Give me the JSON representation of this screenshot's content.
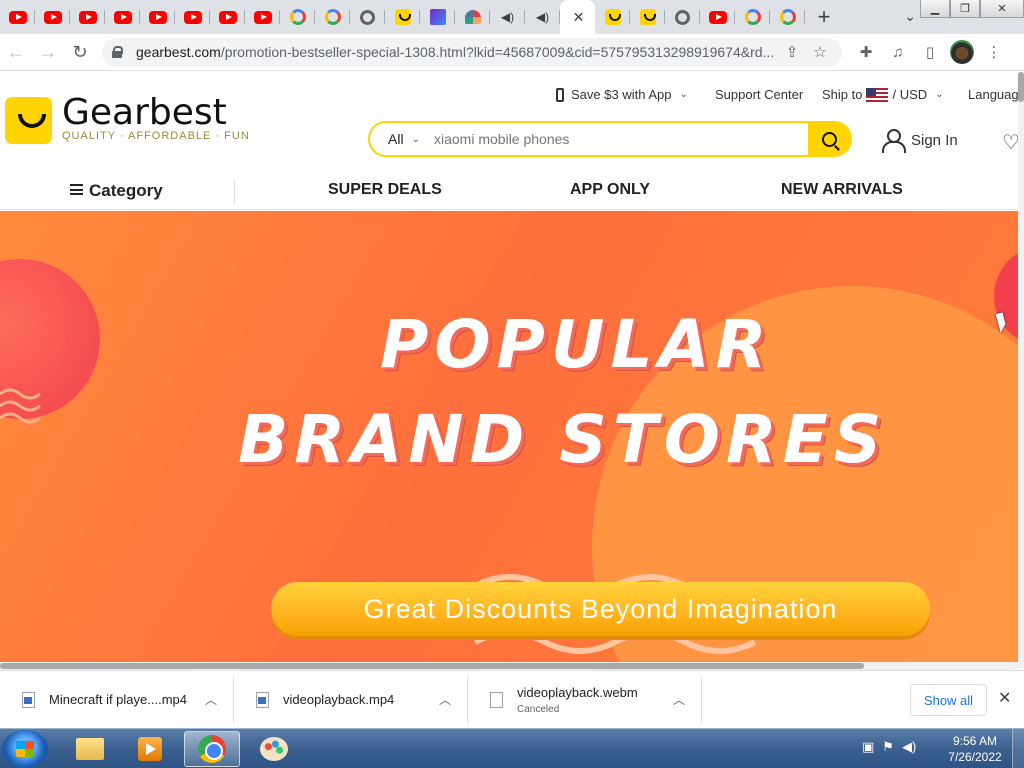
{
  "browser": {
    "tabs": [
      {
        "icon": "youtube-icon"
      },
      {
        "icon": "youtube-icon"
      },
      {
        "icon": "youtube-icon"
      },
      {
        "icon": "youtube-icon"
      },
      {
        "icon": "youtube-icon"
      },
      {
        "icon": "youtube-icon"
      },
      {
        "icon": "youtube-icon"
      },
      {
        "icon": "youtube-icon"
      },
      {
        "icon": "google-icon"
      },
      {
        "icon": "google-icon"
      },
      {
        "icon": "globe-icon"
      },
      {
        "icon": "gearbest-icon"
      },
      {
        "icon": "app-icon"
      },
      {
        "icon": "arc-icon"
      },
      {
        "icon": "speaker-icon"
      },
      {
        "icon": "speaker-icon"
      },
      {
        "icon": "close-icon",
        "active": true
      },
      {
        "icon": "gearbest-icon"
      },
      {
        "icon": "gearbest-icon"
      },
      {
        "icon": "globe-icon"
      },
      {
        "icon": "youtube-icon"
      },
      {
        "icon": "google-icon"
      },
      {
        "icon": "google-icon"
      }
    ],
    "new_tab": "+",
    "url_host": "gearbest.com",
    "url_path": "/promotion-bestseller-special-1308.html?lkid=45687009&cid=575795313298919674&rd..."
  },
  "site": {
    "topbar": {
      "app_promo": "Save $3 with App",
      "support": "Support Center",
      "ship_to": "Ship to",
      "currency": "/ USD",
      "language": "Languag"
    },
    "logo": {
      "name": "Gearbest",
      "tagline": "QUALITY · AFFORDABLE · FUN"
    },
    "search": {
      "category": "All",
      "placeholder": "xiaomi mobile phones"
    },
    "sign_in": "Sign In",
    "nav": {
      "category": "Category",
      "items": [
        "SUPER DEALS",
        "APP ONLY",
        "NEW ARRIVALS"
      ]
    },
    "banner": {
      "line1": "POPULAR",
      "line2": "BRAND STORES",
      "button": "Great Discounts Beyond Imagination"
    }
  },
  "downloads": {
    "items": [
      {
        "name": "Minecraft if playe....mp4",
        "status": ""
      },
      {
        "name": "videoplayback.mp4",
        "status": ""
      },
      {
        "name": "videoplayback.webm",
        "status": "Canceled"
      }
    ],
    "show_all": "Show all"
  },
  "taskbar": {
    "time": "9:56 AM",
    "date": "7/26/2022"
  },
  "colors": {
    "brand_yellow": "#ffd400",
    "banner_orange": "#ff6f3c",
    "link_blue": "#1a73e8"
  }
}
